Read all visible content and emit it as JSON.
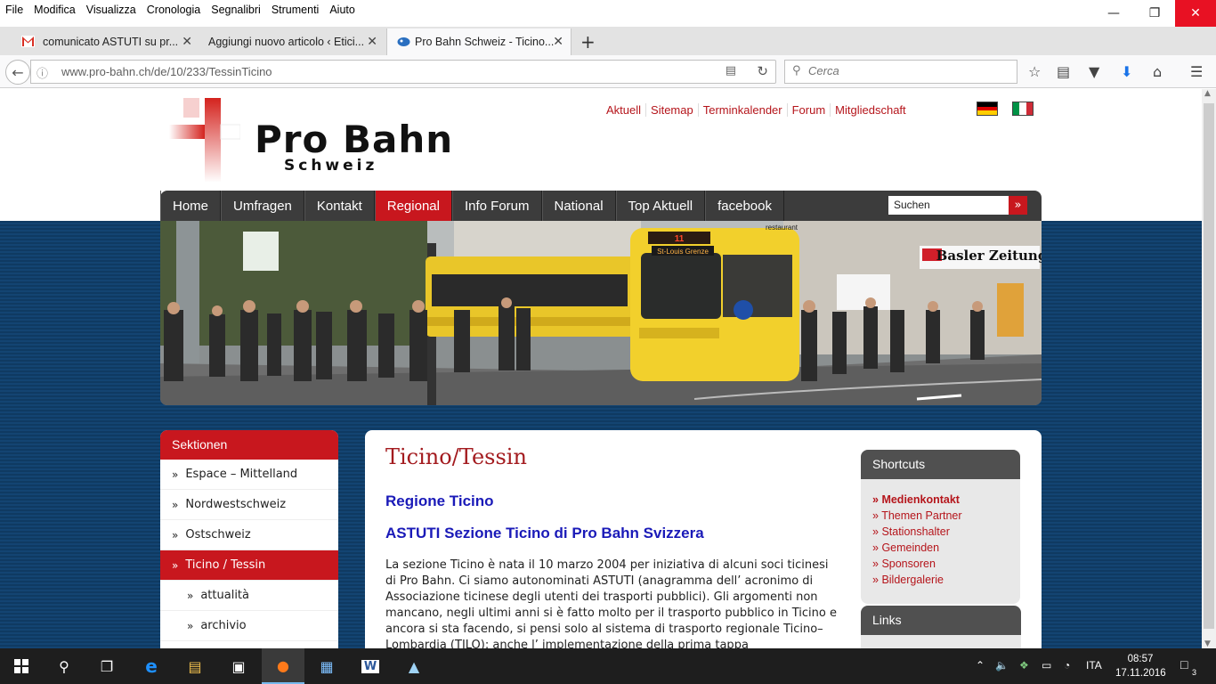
{
  "menubar": [
    "File",
    "Modifica",
    "Visualizza",
    "Cronologia",
    "Segnalibri",
    "Strumenti",
    "Aiuto"
  ],
  "tabs": [
    {
      "title": "comunicato ASTUTI su pr...",
      "icon": "gmail-icon"
    },
    {
      "title": "Aggiungi nuovo articolo ‹ Etici...",
      "icon": "wordpress-icon"
    },
    {
      "title": "Pro Bahn Schweiz - Ticino...",
      "icon": "probahn-favicon"
    }
  ],
  "urlbar": {
    "url": "www.pro-bahn.ch/de/10/233/TessinTicino"
  },
  "search": {
    "placeholder": "Cerca"
  },
  "site": {
    "logo_title": "Pro Bahn",
    "logo_sub": "Schweiz",
    "top_links": [
      "Aktuell",
      "Sitemap",
      "Terminkalender",
      "Forum",
      "Mitgliedschaft"
    ],
    "nav": [
      {
        "label": "Home",
        "active": false
      },
      {
        "label": "Umfragen",
        "active": false
      },
      {
        "label": "Kontakt",
        "active": false
      },
      {
        "label": "Regional",
        "active": true
      },
      {
        "label": "Info Forum",
        "active": false
      },
      {
        "label": "National",
        "active": false
      },
      {
        "label": "Top Aktuell",
        "active": false
      },
      {
        "label": "facebook",
        "active": false
      }
    ],
    "nav_search_value": "Suchen",
    "hero": {
      "tram_display": "11",
      "tram_destination": "St-Louis Grenze",
      "shop_sign": "Basler Zeitung",
      "restaurant_sign": "restaurant"
    },
    "sidebar": {
      "title": "Sektionen",
      "items": [
        {
          "label": "Espace – Mittelland",
          "active": false,
          "sub": false
        },
        {
          "label": "Nordwestschweiz",
          "active": false,
          "sub": false
        },
        {
          "label": "Ostschweiz",
          "active": false,
          "sub": false
        },
        {
          "label": "Ticino / Tessin",
          "active": true,
          "sub": false
        },
        {
          "label": "attualità",
          "active": false,
          "sub": true
        },
        {
          "label": "archivio",
          "active": false,
          "sub": true
        }
      ]
    },
    "content": {
      "title": "Ticino/Tessin",
      "heading1": "Regione Ticino",
      "heading2": "ASTUTI Sezione Ticino di Pro Bahn Svizzera",
      "body": "La sezione Ticino è nata il 10 marzo 2004 per iniziativa di alcuni soci ticinesi di Pro Bahn. Ci siamo autonominati ASTUTI (anagramma dell’ acronimo di Associazione ticinese degli utenti dei trasporti pubblici). Gli argomenti non mancano, negli ultimi anni si è fatto molto per il trasporto pubblico in Ticino e ancora si sta facendo, si pensi solo al sistema di trasporto regionale Ticino–Lombardia (TILO): anche l’ implementazione della prima tappa"
    },
    "shortcuts": {
      "title": "Shortcuts",
      "items": [
        {
          "label": "Medienkontakt",
          "bold": true
        },
        {
          "label": "Themen Partner",
          "bold": false
        },
        {
          "label": "Stationshalter",
          "bold": false
        },
        {
          "label": "Gemeinden",
          "bold": false
        },
        {
          "label": "Sponsoren",
          "bold": false
        },
        {
          "label": "Bildergalerie",
          "bold": false
        }
      ]
    },
    "links_title": "Links"
  },
  "taskbar": {
    "language": "ITA",
    "time": "08:57",
    "date": "17.11.2016",
    "notifications": "3"
  },
  "colors": {
    "brand_red": "#c8171e",
    "link_red": "#b5151b",
    "heading_blue": "#1a1ab8",
    "title_red": "#a31b1f"
  }
}
